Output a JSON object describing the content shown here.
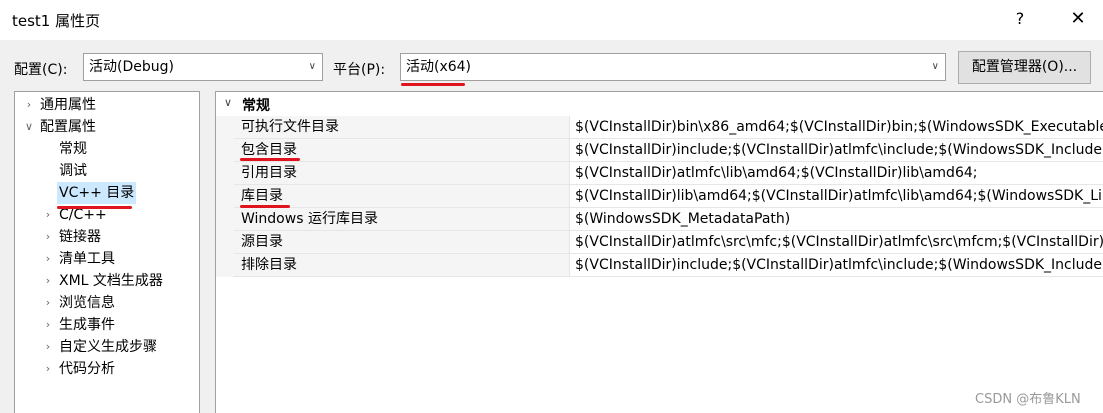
{
  "window": {
    "title": "test1 属性页",
    "help_label": "?",
    "close_label": "✕"
  },
  "toolbar": {
    "config_label": "配置(C):",
    "config_value": "活动(Debug)",
    "platform_label": "平台(P):",
    "platform_value": "活动(x64)",
    "manager_label": "配置管理器(O)...",
    "dropdown_glyph": "∨"
  },
  "tree": {
    "items": [
      {
        "label": "通用属性",
        "expander": "›"
      },
      {
        "label": "配置属性",
        "expander": "∨"
      },
      {
        "label": "常规",
        "expander": ""
      },
      {
        "label": "调试",
        "expander": ""
      },
      {
        "label": "VC++ 目录",
        "expander": "",
        "selected": true
      },
      {
        "label": "C/C++",
        "expander": "›"
      },
      {
        "label": "链接器",
        "expander": "›"
      },
      {
        "label": "清单工具",
        "expander": "›"
      },
      {
        "label": "XML 文档生成器",
        "expander": "›"
      },
      {
        "label": "浏览信息",
        "expander": "›"
      },
      {
        "label": "生成事件",
        "expander": "›"
      },
      {
        "label": "自定义生成步骤",
        "expander": "›"
      },
      {
        "label": "代码分析",
        "expander": "›"
      }
    ]
  },
  "grid": {
    "section_title": "常规",
    "section_expander": "∨",
    "rows": [
      {
        "name": "可执行文件目录",
        "value": "$(VCInstallDir)bin\\x86_amd64;$(VCInstallDir)bin;$(WindowsSDK_ExecutablePath)"
      },
      {
        "name": "包含目录",
        "value": "$(VCInstallDir)include;$(VCInstallDir)atlmfc\\include;$(WindowsSDK_IncludePath)"
      },
      {
        "name": "引用目录",
        "value": "$(VCInstallDir)atlmfc\\lib\\amd64;$(VCInstallDir)lib\\amd64;"
      },
      {
        "name": "库目录",
        "value": "$(VCInstallDir)lib\\amd64;$(VCInstallDir)atlmfc\\lib\\amd64;$(WindowsSDK_LibraryPath)"
      },
      {
        "name": "Windows 运行库目录",
        "value": "$(WindowsSDK_MetadataPath)"
      },
      {
        "name": "源目录",
        "value": "$(VCInstallDir)atlmfc\\src\\mfc;$(VCInstallDir)atlmfc\\src\\mfcm;$(VCInstallDir)"
      },
      {
        "name": "排除目录",
        "value": "$(VCInstallDir)include;$(VCInstallDir)atlmfc\\include;$(WindowsSDK_IncludePath)"
      }
    ]
  },
  "watermark": "CSDN @布鲁KLN",
  "colors": {
    "annotation": "#e0141e",
    "selection": "#cce8ff"
  }
}
